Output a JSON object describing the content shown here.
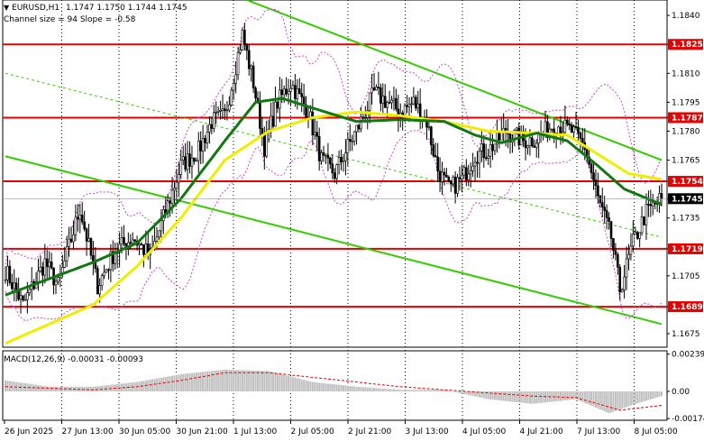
{
  "header": {
    "symbol": "EURUSD,H1",
    "ohlc": "1.1747 1.1750 1.1744 1.1745",
    "channel_note": "Channel size = 94 Slope = -0.58",
    "macd_label": "MACD(12,26,9) -0.00031 -0.00093"
  },
  "colors": {
    "background": "#ffffff",
    "candle": "#000000",
    "level_line": "#e60000",
    "channel": "#33cc00",
    "sma_fast": "#117711",
    "sma_slow": "#eeee00",
    "bollinger": "#cc44cc",
    "macd_hist": "#c0c0c0",
    "macd_signal": "#e60000"
  },
  "chart_data": {
    "type": "candlestick",
    "title": "EURUSD,H1",
    "ylim": [
      1.1668,
      1.1848
    ],
    "y_ticks": [
      "1.1840",
      "1.1825",
      "1.1810",
      "1.1795",
      "1.1787",
      "1.1780",
      "1.1765",
      "1.1754",
      "1.1745",
      "1.1735",
      "1.1719",
      "1.1705",
      "1.1689",
      "1.1675"
    ],
    "x_ticks": [
      "26 Jun 2025",
      "27 Jun 13:00",
      "30 Jun 05:00",
      "30 Jun 21:00",
      "1 Jul 13:00",
      "2 Jul 05:00",
      "2 Jul 21:00",
      "3 Jul 13:00",
      "4 Jul 05:00",
      "4 Jul 21:00",
      "7 Jul 13:00",
      "8 Jul 05:00"
    ],
    "horizontal_levels": [
      {
        "label": "1.1825",
        "value": 1.1825
      },
      {
        "label": "1.1787",
        "value": 1.1787
      },
      {
        "label": "1.1754",
        "value": 1.1754
      },
      {
        "label": "1.1719",
        "value": 1.1719
      },
      {
        "label": "1.1689",
        "value": 1.1689
      }
    ],
    "current_price": {
      "label": "1.1745",
      "value": 1.1745
    },
    "close_anchors": [
      [
        0,
        1.1708
      ],
      [
        8,
        1.169
      ],
      [
        18,
        1.1712
      ],
      [
        24,
        1.17
      ],
      [
        34,
        1.174
      ],
      [
        42,
        1.17
      ],
      [
        50,
        1.1718
      ],
      [
        58,
        1.1725
      ],
      [
        66,
        1.1715
      ],
      [
        72,
        1.1735
      ],
      [
        80,
        1.1762
      ],
      [
        88,
        1.177
      ],
      [
        94,
        1.1785
      ],
      [
        100,
        1.1788
      ],
      [
        108,
        1.183
      ],
      [
        113,
        1.1805
      ],
      [
        118,
        1.1772
      ],
      [
        124,
        1.1795
      ],
      [
        130,
        1.1805
      ],
      [
        138,
        1.179
      ],
      [
        144,
        1.1765
      ],
      [
        150,
        1.1758
      ],
      [
        156,
        1.1772
      ],
      [
        162,
        1.1785
      ],
      [
        168,
        1.18
      ],
      [
        174,
        1.1795
      ],
      [
        180,
        1.179
      ],
      [
        186,
        1.1795
      ],
      [
        192,
        1.1785
      ],
      [
        197,
        1.176
      ],
      [
        202,
        1.175
      ],
      [
        208,
        1.1755
      ],
      [
        214,
        1.1768
      ],
      [
        220,
        1.177
      ],
      [
        228,
        1.178
      ],
      [
        236,
        1.1775
      ],
      [
        242,
        1.1776
      ],
      [
        250,
        1.1784
      ],
      [
        258,
        1.178
      ],
      [
        264,
        1.1772
      ],
      [
        270,
        1.1745
      ],
      [
        276,
        1.1725
      ],
      [
        280,
        1.1698
      ],
      [
        286,
        1.1722
      ],
      [
        292,
        1.1738
      ],
      [
        296,
        1.1742
      ],
      [
        299,
        1.1745
      ]
    ],
    "sma_fast_anchors": [
      [
        0,
        1.1695
      ],
      [
        40,
        1.1712
      ],
      [
        60,
        1.1722
      ],
      [
        80,
        1.1745
      ],
      [
        100,
        1.1775
      ],
      [
        114,
        1.1795
      ],
      [
        126,
        1.1797
      ],
      [
        140,
        1.1792
      ],
      [
        160,
        1.1785
      ],
      [
        180,
        1.1786
      ],
      [
        200,
        1.1785
      ],
      [
        214,
        1.1778
      ],
      [
        226,
        1.1774
      ],
      [
        242,
        1.1779
      ],
      [
        256,
        1.1775
      ],
      [
        270,
        1.1762
      ],
      [
        282,
        1.175
      ],
      [
        299,
        1.1742
      ]
    ],
    "sma_slow_anchors": [
      [
        0,
        1.167
      ],
      [
        40,
        1.169
      ],
      [
        60,
        1.171
      ],
      [
        80,
        1.1735
      ],
      [
        100,
        1.1765
      ],
      [
        120,
        1.178
      ],
      [
        140,
        1.1787
      ],
      [
        160,
        1.179
      ],
      [
        180,
        1.1788
      ],
      [
        200,
        1.1785
      ],
      [
        220,
        1.178
      ],
      [
        240,
        1.1779
      ],
      [
        256,
        1.1778
      ],
      [
        270,
        1.1768
      ],
      [
        284,
        1.1758
      ],
      [
        299,
        1.1755
      ]
    ],
    "channel_upper": [
      [
        110,
        1.1848
      ],
      [
        299,
        1.1765
      ]
    ],
    "channel_lower": [
      [
        0,
        1.1767
      ],
      [
        299,
        1.168
      ]
    ],
    "channel_mid": [
      [
        0,
        1.181
      ],
      [
        299,
        1.1725
      ]
    ],
    "macd": {
      "label": "MACD(12,26,9)",
      "macd_value": -0.00031,
      "signal_value": -0.00093,
      "y_ticks": [
        "0.00239",
        "0.00",
        "-0.00174"
      ],
      "ylim": [
        -0.00185,
        0.0026
      ],
      "hist_anchors": [
        [
          0,
          0.0007
        ],
        [
          20,
          0.0003
        ],
        [
          40,
          0.0003
        ],
        [
          60,
          0.0006
        ],
        [
          80,
          0.0011
        ],
        [
          100,
          0.0014
        ],
        [
          120,
          0.0013
        ],
        [
          140,
          0.0006
        ],
        [
          160,
          0.0003
        ],
        [
          180,
          0.0001
        ],
        [
          200,
          0.0001
        ],
        [
          220,
          -0.0005
        ],
        [
          240,
          -0.0008
        ],
        [
          260,
          -0.0005
        ],
        [
          275,
          -0.0014
        ],
        [
          285,
          -0.0009
        ],
        [
          299,
          -0.0003
        ]
      ],
      "signal_anchors": [
        [
          0,
          0.0003
        ],
        [
          40,
          0.0001
        ],
        [
          60,
          0.0003
        ],
        [
          80,
          0.0007
        ],
        [
          100,
          0.0012
        ],
        [
          120,
          0.0012
        ],
        [
          140,
          0.0009
        ],
        [
          160,
          0.0006
        ],
        [
          180,
          0.0003
        ],
        [
          200,
          0.0001
        ],
        [
          220,
          -0.0001
        ],
        [
          240,
          -0.0003
        ],
        [
          260,
          -0.0004
        ],
        [
          280,
          -0.0012
        ],
        [
          299,
          -0.0009
        ]
      ]
    }
  }
}
